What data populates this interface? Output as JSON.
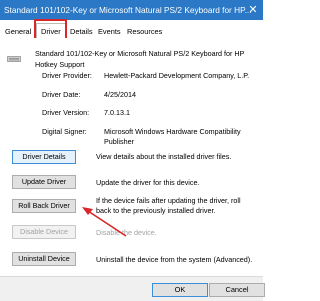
{
  "window": {
    "title": "Standard 101/102-Key or Microsoft Natural PS/2 Keyboard for HP...",
    "close_glyph": "✕"
  },
  "tabs": [
    "General",
    "Driver",
    "Details",
    "Events",
    "Resources"
  ],
  "device": {
    "name": "Standard 101/102-Key or Microsoft Natural PS/2 Keyboard for HP Hotkey Support",
    "icon": "keyboard-icon"
  },
  "driver_info": {
    "provider_label": "Driver Provider:",
    "provider": "Hewlett-Packard Development Company, L.P.",
    "date_label": "Driver Date:",
    "date": "4/25/2014",
    "version_label": "Driver Version:",
    "version": "7.0.13.1",
    "signer_label": "Digital Signer:",
    "signer": "Microsoft Windows Hardware Compatibility Publisher"
  },
  "actions": [
    {
      "label": "Driver Details",
      "desc": "View details about the installed driver files."
    },
    {
      "label": "Update Driver",
      "desc": "Update the driver for this device."
    },
    {
      "label": "Roll Back Driver",
      "desc": "If the device fails after updating the driver, roll back to the previously installed driver."
    },
    {
      "label": "Disable Device",
      "desc": "Disable the device."
    },
    {
      "label": "Uninstall Device",
      "desc": "Uninstall the device from the system (Advanced)."
    }
  ],
  "footer": {
    "ok": "OK",
    "cancel": "Cancel"
  },
  "annotation_color": "#d9262a"
}
